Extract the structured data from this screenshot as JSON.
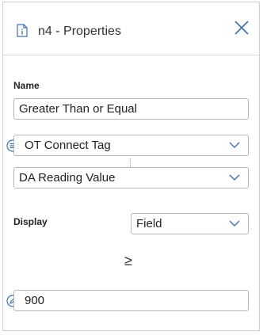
{
  "panel": {
    "title": "n4 - Properties"
  },
  "name_section": {
    "label": "Name",
    "value": "Greater Than or Equal"
  },
  "source_select": {
    "value": "OT Connect Tag"
  },
  "field_select": {
    "value": "DA Reading Value"
  },
  "display_section": {
    "label": "Display",
    "value": "Field"
  },
  "operator": {
    "symbol": "≥"
  },
  "value_input": {
    "value": "900"
  },
  "colors": {
    "accent": "#3e6fb3",
    "border": "#b7b7b7"
  },
  "icons": {
    "header": "document-icon",
    "close": "close-icon",
    "source": "list-icon",
    "value": "edit-icon"
  }
}
